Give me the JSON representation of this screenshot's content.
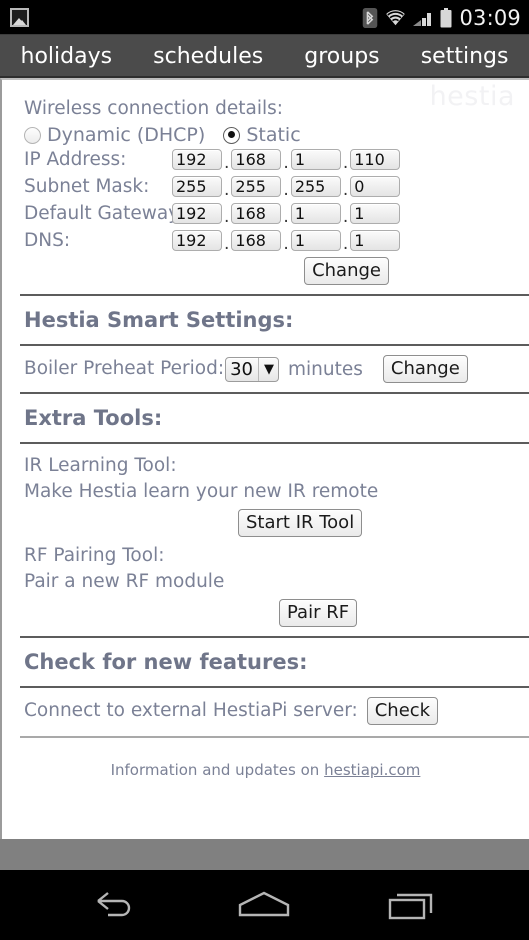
{
  "status_bar": {
    "notification_icon": "image-notification-icon",
    "bluetooth_icon": "bluetooth-icon",
    "wifi_icon": "wifi-icon",
    "signal_icon": "cellular-signal-icon",
    "battery_icon": "battery-icon",
    "clock": "03:09"
  },
  "top_nav": {
    "items": [
      {
        "label": "holidays"
      },
      {
        "label": "schedules"
      },
      {
        "label": "groups"
      },
      {
        "label": "settings"
      }
    ]
  },
  "page": {
    "watermark": "hestia",
    "wireless": {
      "title": "Wireless connection details:",
      "modes": [
        {
          "label": "Dynamic (DHCP)",
          "selected": false
        },
        {
          "label": "Static",
          "selected": true
        }
      ],
      "fields": [
        {
          "label": "IP Address:",
          "octets": [
            "192",
            "168",
            "1",
            "110"
          ]
        },
        {
          "label": "Subnet Mask:",
          "octets": [
            "255",
            "255",
            "255",
            "0"
          ]
        },
        {
          "label": "Default Gateway:",
          "octets": [
            "192",
            "168",
            "1",
            "1"
          ]
        },
        {
          "label": "DNS:",
          "octets": [
            "192",
            "168",
            "1",
            "1"
          ]
        }
      ],
      "change_label": "Change",
      "dot": "."
    },
    "smart_settings": {
      "heading": "Hestia Smart Settings:",
      "preheat_label": "Boiler Preheat Period:",
      "preheat_value": "30",
      "preheat_options": [
        "30"
      ],
      "units": "minutes",
      "change_label": "Change",
      "chevron": "▼"
    },
    "extra_tools": {
      "heading": "Extra Tools:",
      "ir": {
        "title": "IR Learning Tool:",
        "description": "Make Hestia learn your new IR remote",
        "button_label": "Start IR Tool"
      },
      "rf": {
        "title": "RF Pairing Tool:",
        "description": "Pair a new RF module",
        "button_label": "Pair RF"
      }
    },
    "features": {
      "heading": "Check for new features:",
      "connect_label": "Connect to external HestiaPi server:",
      "button_label": "Check"
    },
    "footer": {
      "text": "Information and updates on",
      "link": "hestiapi.com"
    }
  },
  "android_nav": {
    "back_icon": "back-arrow-icon",
    "home_icon": "home-icon",
    "recents_icon": "recent-apps-icon"
  },
  "colors": {
    "status_bar_bg": "#000000",
    "top_nav_bg": "#4b4b4b",
    "page_bg": "#ffffff",
    "label_text": "#7b8196",
    "heading_text": "#6f7589",
    "outer_bg": "#808080"
  }
}
